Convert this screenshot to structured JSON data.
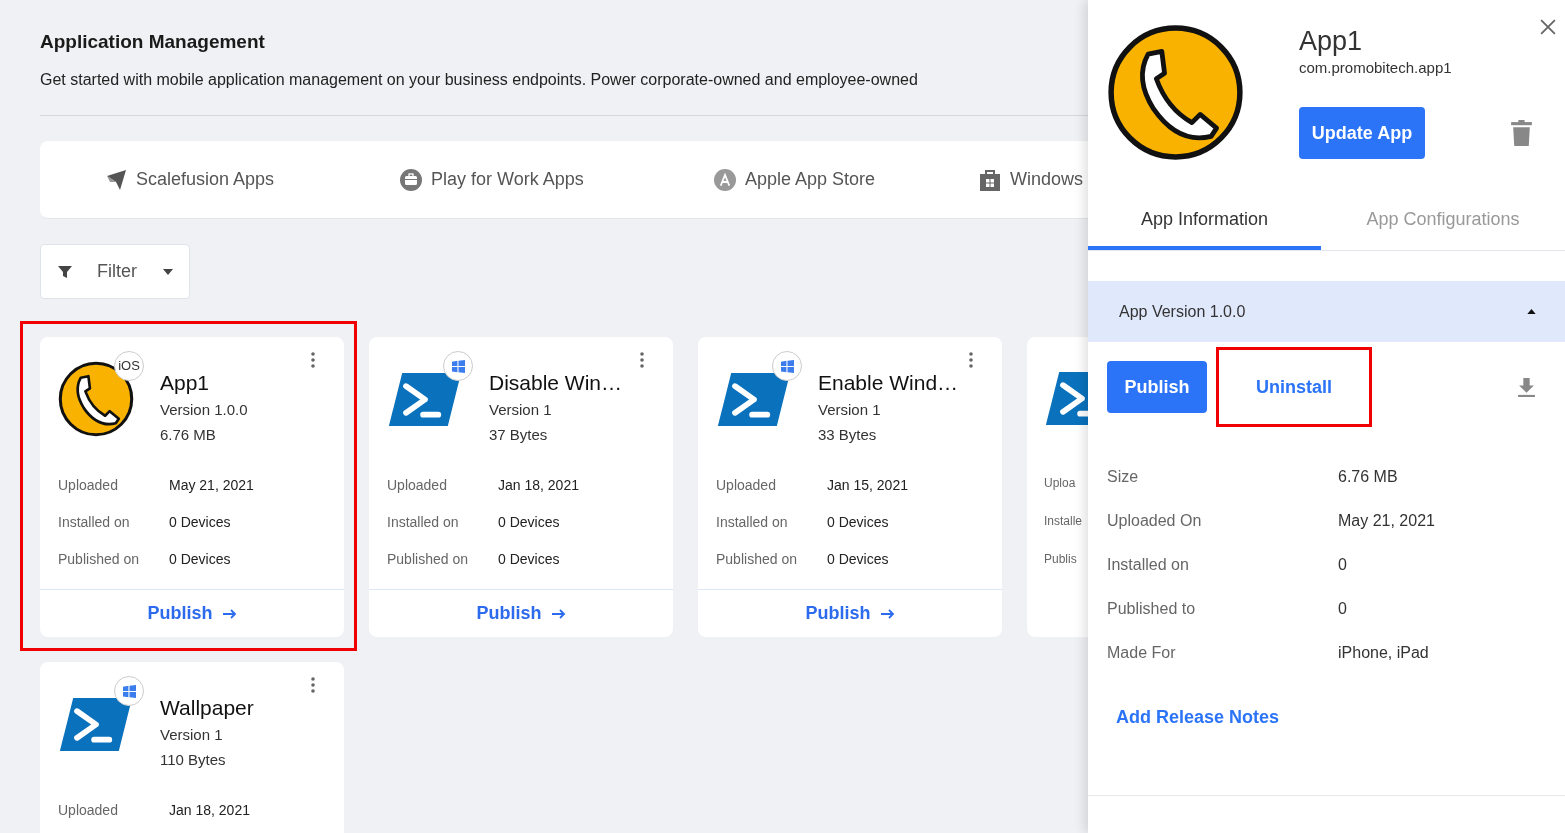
{
  "page": {
    "title": "Application Management",
    "description": "Get started with mobile application management on your business endpoints. Power corporate-owned and employee-owned"
  },
  "source_tabs": [
    {
      "label": "Scalefusion Apps"
    },
    {
      "label": "Play for Work Apps"
    },
    {
      "label": "Apple App Store"
    },
    {
      "label": "Windows"
    }
  ],
  "filter": {
    "label": "Filter"
  },
  "cards": [
    {
      "kind": "ios",
      "name": "App1",
      "platform_label": "iOS",
      "version": "Version 1.0.0",
      "size": "6.76 MB",
      "highlighted": true,
      "rows": [
        {
          "label": "Uploaded",
          "value": "May 21, 2021"
        },
        {
          "label": "Installed on",
          "value": "0 Devices"
        },
        {
          "label": "Published on",
          "value": "0 Devices"
        }
      ],
      "action": "Publish"
    },
    {
      "kind": "windows",
      "name": "Disable Win…",
      "version": "Version 1",
      "size": "37 Bytes",
      "highlighted": false,
      "rows": [
        {
          "label": "Uploaded",
          "value": "Jan 18, 2021"
        },
        {
          "label": "Installed on",
          "value": "0 Devices"
        },
        {
          "label": "Published on",
          "value": "0 Devices"
        }
      ],
      "action": "Publish"
    },
    {
      "kind": "windows",
      "name": "Enable Wind…",
      "version": "Version 1",
      "size": "33 Bytes",
      "highlighted": false,
      "rows": [
        {
          "label": "Uploaded",
          "value": "Jan 15, 2021"
        },
        {
          "label": "Installed on",
          "value": "0 Devices"
        },
        {
          "label": "Published on",
          "value": "0 Devices"
        }
      ],
      "action": "Publish"
    },
    {
      "kind": "windows-clipped",
      "highlighted": false,
      "rows": [
        {
          "label": "Uploa"
        },
        {
          "label": "Installe"
        },
        {
          "label": "Publis"
        }
      ]
    },
    {
      "kind": "windows",
      "name": "Wallpaper",
      "version": "Version 1",
      "size": "110 Bytes",
      "highlighted": false,
      "rows": [
        {
          "label": "Uploaded",
          "value": "Jan 18, 2021"
        }
      ]
    }
  ],
  "panel": {
    "name": "App1",
    "package": "com.promobitech.app1",
    "update_button": "Update App",
    "tabs": [
      {
        "label": "App Information",
        "selected": true
      },
      {
        "label": "App Configurations",
        "selected": false
      }
    ],
    "version_section": {
      "title": "App Version 1.0.0",
      "expanded": true,
      "buttons": [
        {
          "label": "Publish",
          "kind": "primary",
          "highlighted": false
        },
        {
          "label": "Uninstall",
          "kind": "link",
          "highlighted": true
        }
      ],
      "details": [
        {
          "label": "Size",
          "value": "6.76 MB"
        },
        {
          "label": "Uploaded On",
          "value": "May 21, 2021"
        },
        {
          "label": "Installed on",
          "value": "0"
        },
        {
          "label": "Published to",
          "value": "0"
        },
        {
          "label": "Made For",
          "value": "iPhone, iPad"
        }
      ]
    },
    "release_notes_link": "Add Release Notes"
  }
}
